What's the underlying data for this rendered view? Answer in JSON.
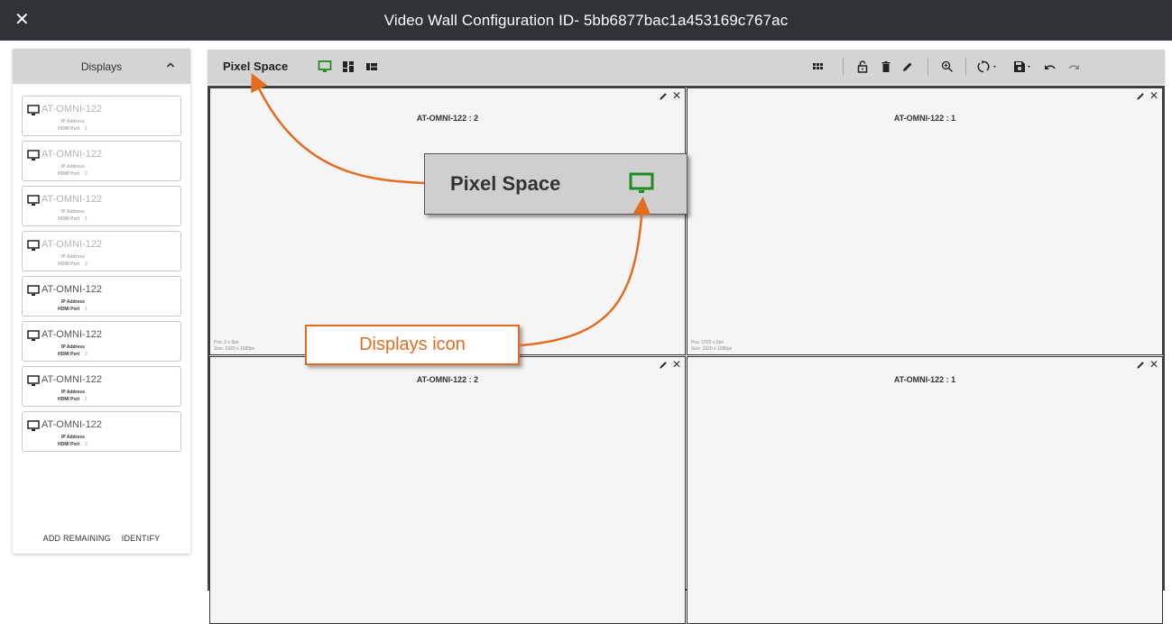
{
  "window": {
    "title": "Video Wall Configuration ID- 5bb6877bac1a453169c767ac",
    "close_icon": "close-icon"
  },
  "sidebar": {
    "title": "Displays",
    "collapse_icon": "chevron-up-icon",
    "cards": [
      {
        "name": "AT-OMNI-122",
        "ip_label": "IP Address",
        "port_label": "HDMI Port",
        "port": "1",
        "state": "dim"
      },
      {
        "name": "AT-OMNI-122",
        "ip_label": "IP Address",
        "port_label": "HDMI Port",
        "port": "2",
        "state": "dim"
      },
      {
        "name": "AT-OMNI-122",
        "ip_label": "IP Address",
        "port_label": "HDMI Port",
        "port": "1",
        "state": "dim"
      },
      {
        "name": "AT-OMNI-122",
        "ip_label": "IP Address",
        "port_label": "HDMI Port",
        "port": "2",
        "state": "dim"
      },
      {
        "name": "AT-OMNI-122",
        "ip_label": "IP Address",
        "port_label": "HDMI Port",
        "port": "1",
        "state": "active"
      },
      {
        "name": "AT-OMNI-122",
        "ip_label": "IP Address",
        "port_label": "HDMI Port",
        "port": "2",
        "state": "active"
      },
      {
        "name": "AT-OMNI-122",
        "ip_label": "IP Address",
        "port_label": "HDMI Port",
        "port": "1",
        "state": "active"
      },
      {
        "name": "AT-OMNI-122",
        "ip_label": "IP Address",
        "port_label": "HDMI Port",
        "port": "2",
        "state": "active"
      }
    ],
    "add_remaining": "ADD REMAINING",
    "identify": "IDENTIFY"
  },
  "toolbar": {
    "label": "Pixel Space",
    "left_icons": [
      "monitor-icon",
      "dashboard-icon",
      "grid-view-icon"
    ],
    "right_icons": [
      "apps-grid-icon",
      "unlock-icon",
      "delete-icon",
      "edit-icon",
      "zoom-in-icon",
      "sync-icon",
      "save-icon",
      "undo-icon",
      "redo-icon"
    ]
  },
  "tiles": [
    {
      "name": "AT-OMNI-122 : 2",
      "pos": "Pos: 0 x 0px",
      "size": "Size: 1920 x 1080px"
    },
    {
      "name": "AT-OMNI-122 : 1",
      "pos": "Pos: 1920 x 0px",
      "size": "Size: 1920 x 1080px"
    },
    {
      "name": "AT-OMNI-122 : 2",
      "pos": "",
      "size": ""
    },
    {
      "name": "AT-OMNI-122 : 1",
      "pos": "",
      "size": ""
    }
  ],
  "annotations": {
    "pixel_space_label": "Pixel Space",
    "displays_icon_label": "Displays icon",
    "accent_color": "#e36c21",
    "monitor_green": "#1e8c1e"
  }
}
